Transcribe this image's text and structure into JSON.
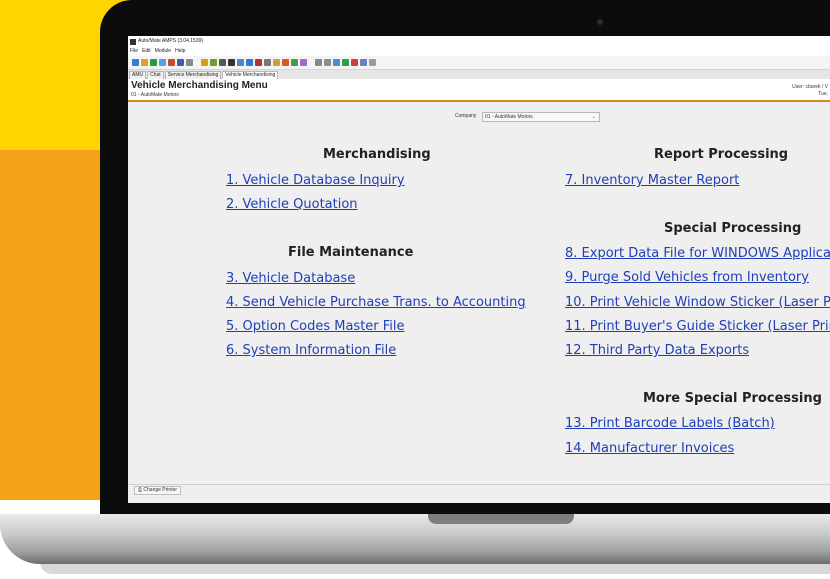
{
  "window": {
    "title": "Auto/Mate AMPS (3.04.1539)",
    "menu": [
      "File",
      "Edit",
      "Module",
      "Help"
    ]
  },
  "tabs": [
    "AMU",
    "Chat",
    "Service Merchandising",
    "Vehicle Merchandising"
  ],
  "header": {
    "title": "Vehicle Merchandising Menu",
    "subtitle": "01 - AutoMate Motors",
    "user": "User: cburek / V",
    "date": "Tue,"
  },
  "company": {
    "label": "Company",
    "value": "01 - AutoMate Motors"
  },
  "sections": {
    "merchandising": {
      "title": "Merchandising",
      "items": [
        "1.  Vehicle Database Inquiry",
        "2.  Vehicle Quotation"
      ]
    },
    "file_maintenance": {
      "title": "File Maintenance",
      "items": [
        "3.  Vehicle Database",
        "4.  Send Vehicle Purchase Trans. to Accounting",
        "5.  Option Codes Master File",
        "6.  System Information File"
      ]
    },
    "report_processing": {
      "title": "Report Processing",
      "items": [
        "7.  Inventory Master Report"
      ]
    },
    "special_processing": {
      "title": "Special Processing",
      "items": [
        "8.  Export Data File for WINDOWS Applica",
        "9.  Purge Sold Vehicles from Inventory",
        "10.  Print Vehicle Window Sticker (Laser Pr",
        "11.  Print Buyer's Guide Sticker (Laser Prin",
        "12.  Third Party Data Exports"
      ]
    },
    "more_special_processing": {
      "title": "More Special Processing",
      "items": [
        "13.  Print Barcode Labels (Batch)",
        "14.  Manufacturer Invoices"
      ]
    }
  },
  "statusbar": {
    "change_printer": "Change Printer"
  },
  "colors": {
    "yellow": "#ffd400",
    "orange": "#f5a21b",
    "link": "#1f3fb8",
    "header_rule": "#d08a1f"
  }
}
